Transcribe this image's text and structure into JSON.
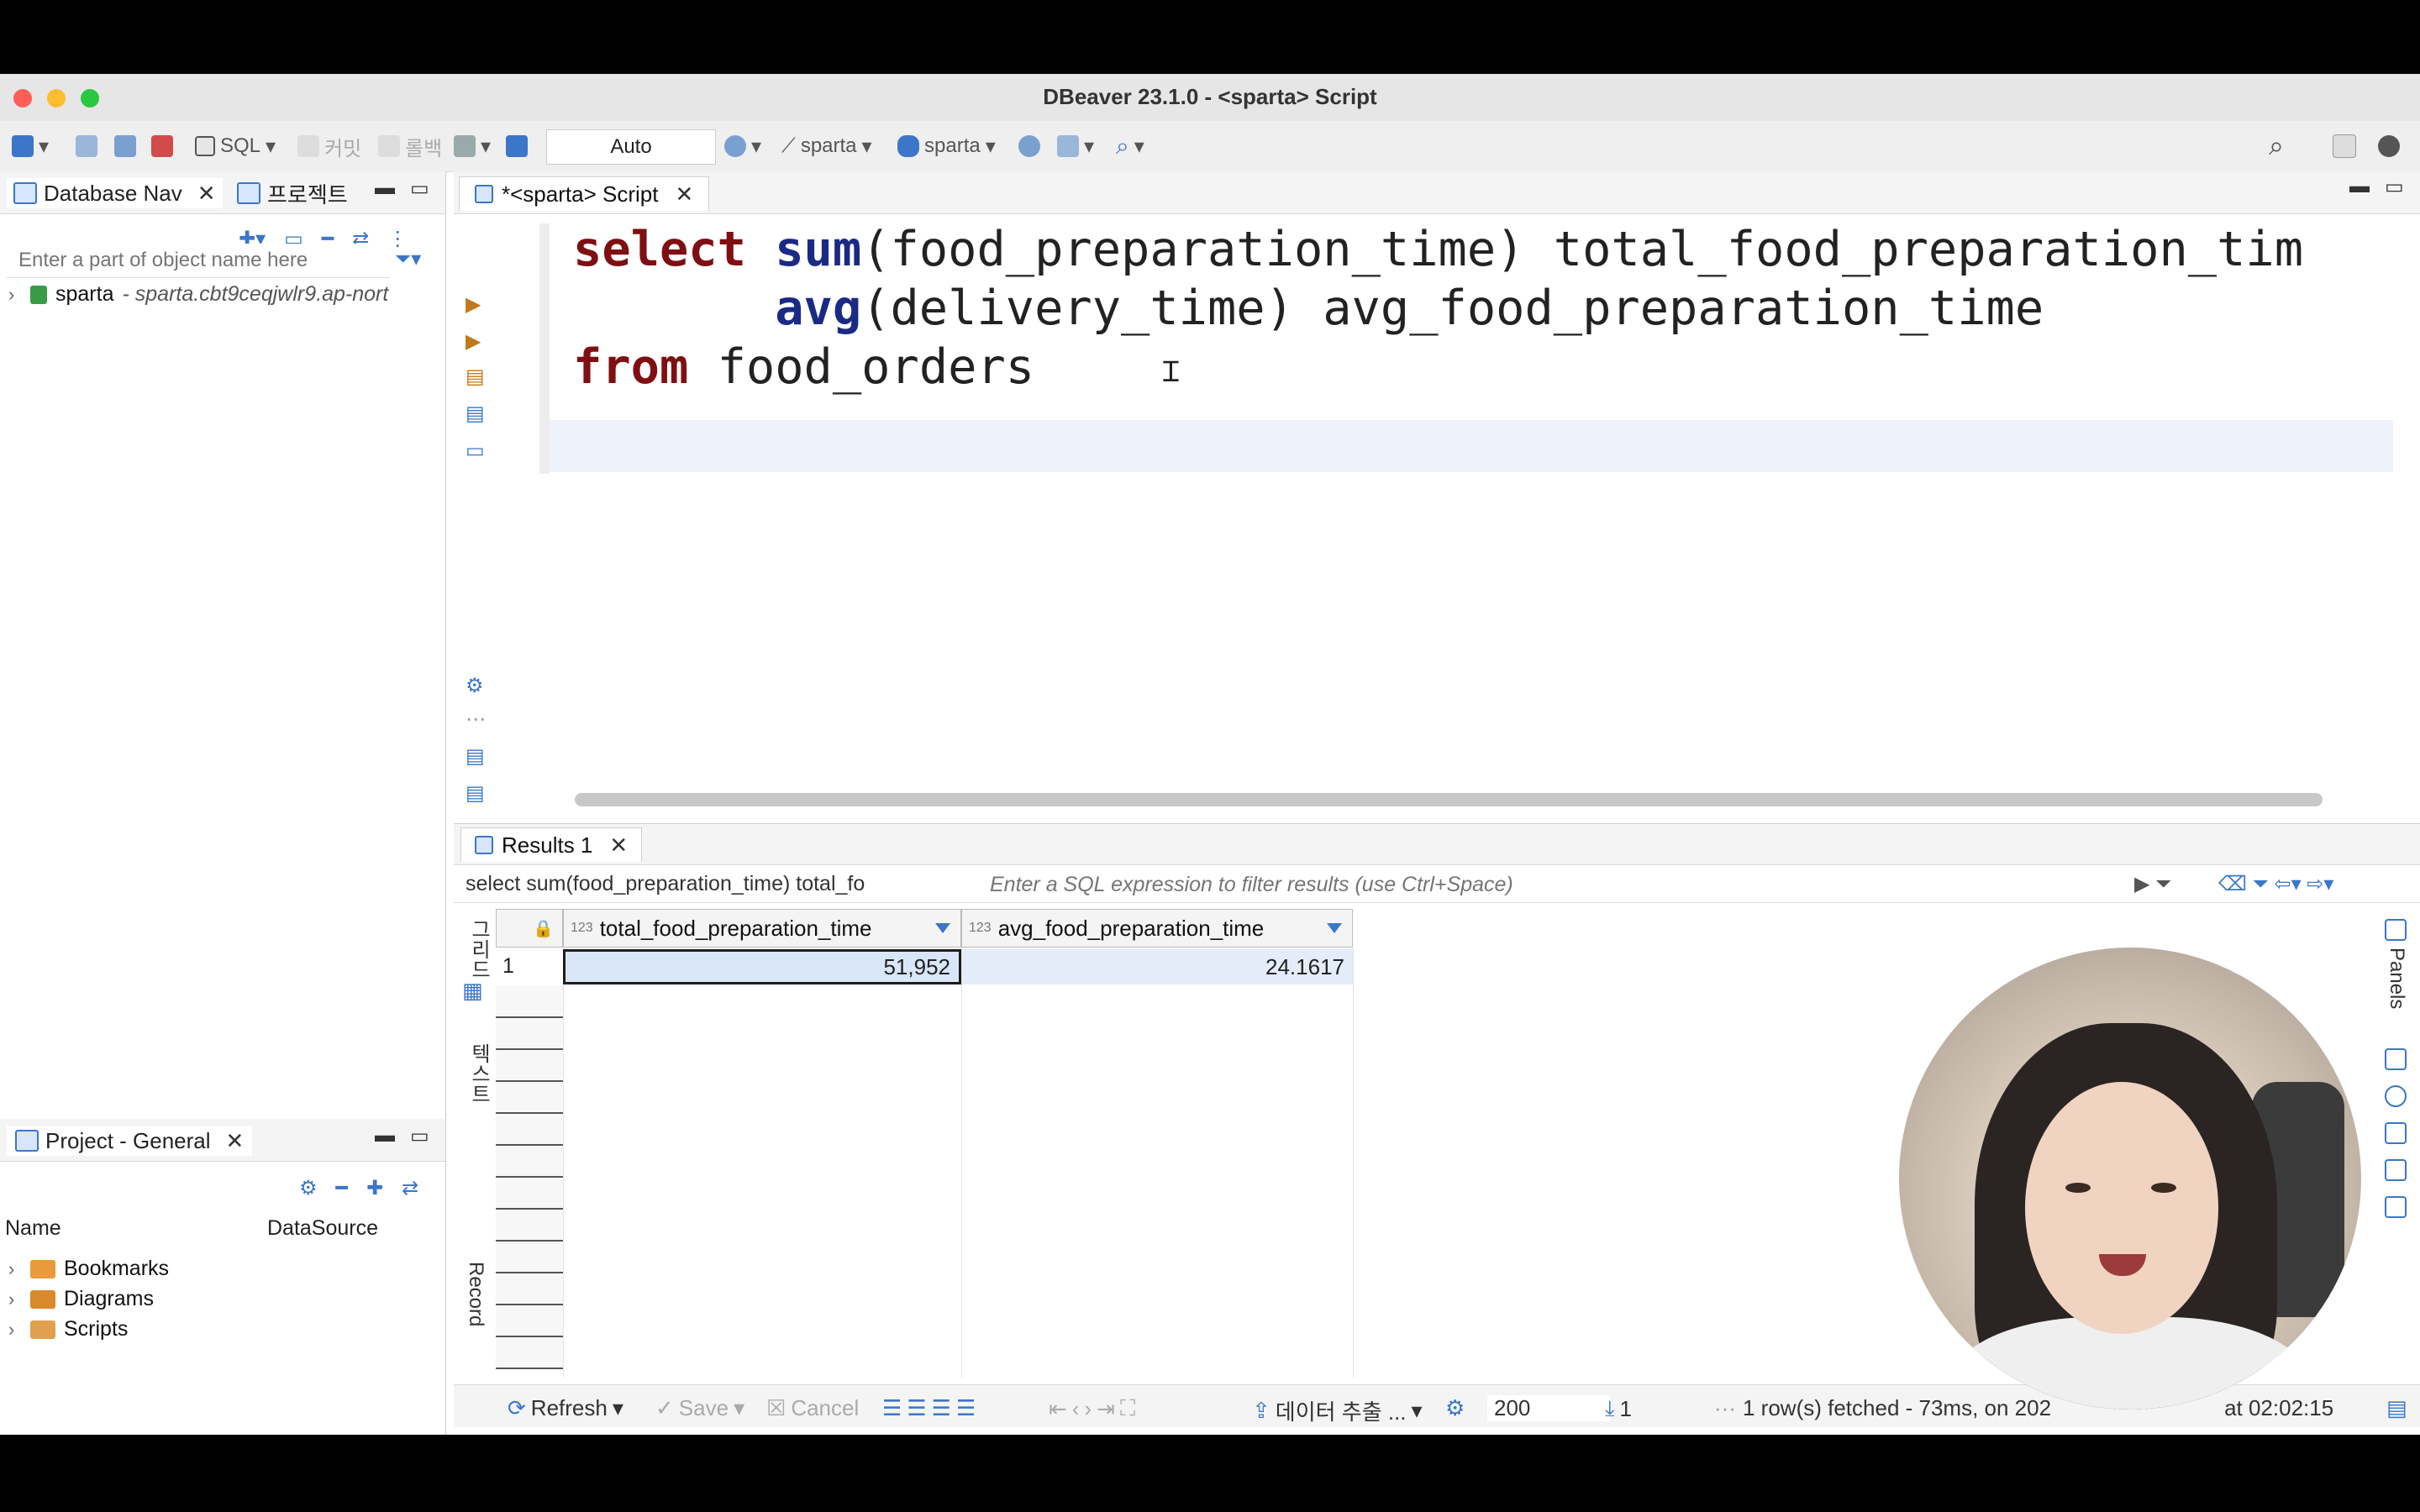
{
  "window": {
    "title": "DBeaver 23.1.0 - <sparta> Script"
  },
  "toolbar": {
    "sql_label": "SQL",
    "commit_label": "커밋",
    "rollback_label": "롤백",
    "auto_label": "Auto",
    "datasource1": "sparta",
    "datasource2": "sparta"
  },
  "left_panel": {
    "tab_db_nav": "Database Nav",
    "tab_project": "프로젝트",
    "filter_placeholder": "Enter a part of object name here",
    "connection_name": "sparta",
    "connection_host": "- sparta.cbt9ceqjwlr9.ap-nort"
  },
  "project_panel": {
    "title": "Project - General",
    "col_name": "Name",
    "col_datasource": "DataSource",
    "items": [
      "Bookmarks",
      "Diagrams",
      "Scripts"
    ]
  },
  "editor": {
    "tab_label": "*<sparta> Script",
    "line1_kw": "select",
    "line1_fn": "sum",
    "line1_rest": "(food_preparation_time) total_food_preparation_tim",
    "line2_fn": "avg",
    "line2_rest": "(delivery_time) avg_food_preparation_time",
    "line3_kw": "from",
    "line3_rest": " food_orders"
  },
  "results": {
    "tab_label": "Results 1",
    "query_chip": "select sum(food_preparation_time) total_fo",
    "filter_placeholder": "Enter a SQL expression to filter results (use Ctrl+Space)",
    "side_grid_label": "그리드",
    "side_text_label": "텍스트",
    "side_record_label": "Record",
    "panels_label": "Panels",
    "columns": [
      {
        "type_tag": "123",
        "name": "total_food_preparation_time"
      },
      {
        "type_tag": "123",
        "name": "avg_food_preparation_time"
      }
    ],
    "rows": [
      {
        "num": "1",
        "values": [
          "51,952",
          "24.1617"
        ]
      }
    ]
  },
  "statusbar": {
    "refresh": "Refresh",
    "save": "Save",
    "cancel": "Cancel",
    "export": "데이터 추출 ...",
    "fetch_size": "200",
    "row_count": "1",
    "status": "1 row(s) fetched - 73ms, on 202",
    "status_time": "at 02:02:15"
  },
  "colors": {
    "keyword": "#7f0f12",
    "function": "#1b2a85",
    "accent": "#3b76c8"
  },
  "icons": [
    "new-connection-icon",
    "sql-editor-icon",
    "commit-icon",
    "rollback-icon",
    "transaction-icon",
    "search-icon",
    "gear-icon",
    "filter-icon",
    "close-icon",
    "chevron-right-icon"
  ]
}
